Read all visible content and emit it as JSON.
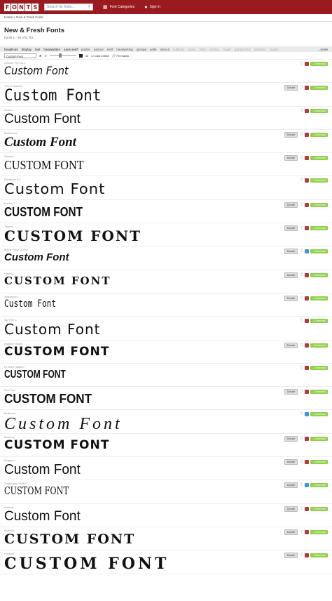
{
  "header": {
    "logo_letters": [
      "F",
      "O",
      "N",
      "T",
      "S"
    ],
    "search_placeholder": "Search for fonts...",
    "nav": [
      {
        "label": "Font Categories",
        "icon": "grid-icon"
      },
      {
        "label": "Sign In",
        "icon": "user-icon"
      }
    ]
  },
  "breadcrumb": "Home > New & Fresh Fonts",
  "page": {
    "title": "New & Fresh Fonts",
    "count": "Fonts 1 - 30 of 8,751"
  },
  "categories": {
    "items": [
      "headlines",
      "display",
      "text",
      "handwritten",
      "sans serif",
      "poster",
      "narrow",
      "serif",
      "handwriting",
      "grunge",
      "wide",
      "stencil",
      "outlined",
      "comic",
      "retro",
      "techno",
      "rough",
      "grunge text",
      "futuristic",
      "classic"
    ],
    "more": "...more"
  },
  "toolbar": {
    "preview_text": "Custom Font",
    "size_value": "30",
    "dark_label": "Dark edition",
    "permalink": "Permalink"
  },
  "fonts": [
    {
      "name": "Chewie Pen 50-1",
      "sample": "Custom Font",
      "donate": false,
      "blue": false
    },
    {
      "name": "TOLG Tasteful",
      "sample": "Custom Font",
      "donate": true,
      "blue": false
    },
    {
      "name": "Arctic-1",
      "sample": "Custom Font",
      "donate": false,
      "blue": false
    },
    {
      "name": "Brotherina",
      "sample": "Custom Font",
      "donate": true,
      "blue": false
    },
    {
      "name": "Gaderri",
      "sample": "CUSTOM FONT",
      "donate": true,
      "blue": false
    },
    {
      "name": "Plenitude 6-1",
      "sample": "Custom Font",
      "donate": false,
      "blue": false
    },
    {
      "name": "Fusion-1",
      "sample": "CUSTOM FONT",
      "donate": true,
      "blue": false
    },
    {
      "name": "Taranis",
      "sample": "CUSTOM FONT",
      "donate": true,
      "blue": false
    },
    {
      "name": "Bryce Party DEMO",
      "sample": "Custom Font",
      "donate": true,
      "blue": true
    },
    {
      "name": "Stenny",
      "sample": "CUSTOM FONT",
      "donate": true,
      "blue": false
    },
    {
      "name": "Strawberry",
      "sample": "Custom Font",
      "donate": true,
      "blue": false
    },
    {
      "name": "Sw Fine-1",
      "sample": "Custom Font",
      "donate": false,
      "blue": false
    },
    {
      "name": "Eggnoir Heavy",
      "sample": "CUSTOM FONT",
      "donate": true,
      "blue": false
    },
    {
      "name": "El Jefes Stallion",
      "sample": "CUSTOM FONT",
      "donate": false,
      "blue": false
    },
    {
      "name": "Port Two",
      "sample": "CUSTOM FONT",
      "donate": true,
      "blue": false
    },
    {
      "name": "Bellerose",
      "sample": "Custom Font",
      "donate": false,
      "blue": true
    },
    {
      "name": "Bonanry",
      "sample": "CUSTOM FONT",
      "donate": true,
      "blue": false
    },
    {
      "name": "Kingmen",
      "sample": "Custom Font",
      "donate": true,
      "blue": false
    },
    {
      "name": "Tradetone DEMO",
      "sample": "CUSTOM FONT",
      "donate": true,
      "blue": true
    },
    {
      "name": "Aldinalt",
      "sample": "Custom Font",
      "donate": true,
      "blue": false
    },
    {
      "name": "Berkshir",
      "sample": "CUSTOM FONT",
      "donate": true,
      "blue": false
    },
    {
      "name": "Fontdeli",
      "sample": "CUSTOM FONT",
      "donate": true,
      "blue": false
    }
  ],
  "labels": {
    "donate": "Donate",
    "download": "Download"
  }
}
